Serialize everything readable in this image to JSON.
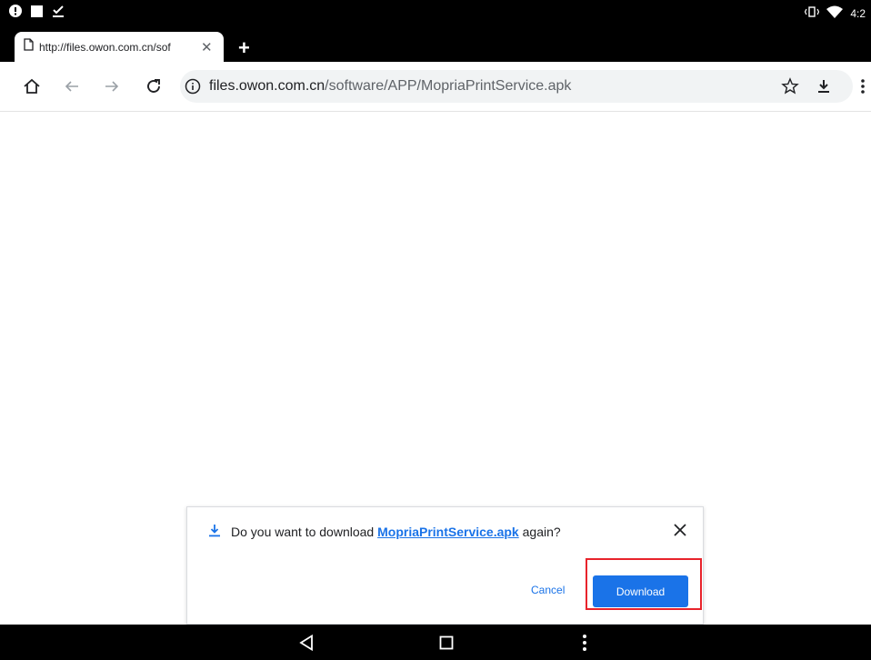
{
  "status_bar": {
    "time": "4:2",
    "icons": [
      "alert-icon",
      "square-icon",
      "download-done-icon",
      "vibrate-icon",
      "wifi-icon"
    ]
  },
  "tabs": [
    {
      "title": "http://files.owon.com.cn/sof"
    }
  ],
  "toolbar": {
    "url_host": "files.owon.com.cn",
    "url_path": "/software/APP/MopriaPrintService.apk",
    "icons": [
      "home-icon",
      "back-icon",
      "forward-icon",
      "reload-icon",
      "info-icon",
      "bookmark-star-icon",
      "download-icon",
      "more-vert-icon"
    ]
  },
  "download_prompt": {
    "text_before": "Do you want to download ",
    "filename": "MopriaPrintService.apk",
    "text_after": " again?",
    "cancel_label": "Cancel",
    "download_label": "Download"
  },
  "colors": {
    "accent": "#1a73e8",
    "highlight": "#e8232b",
    "chrome_dark": "#000000"
  }
}
